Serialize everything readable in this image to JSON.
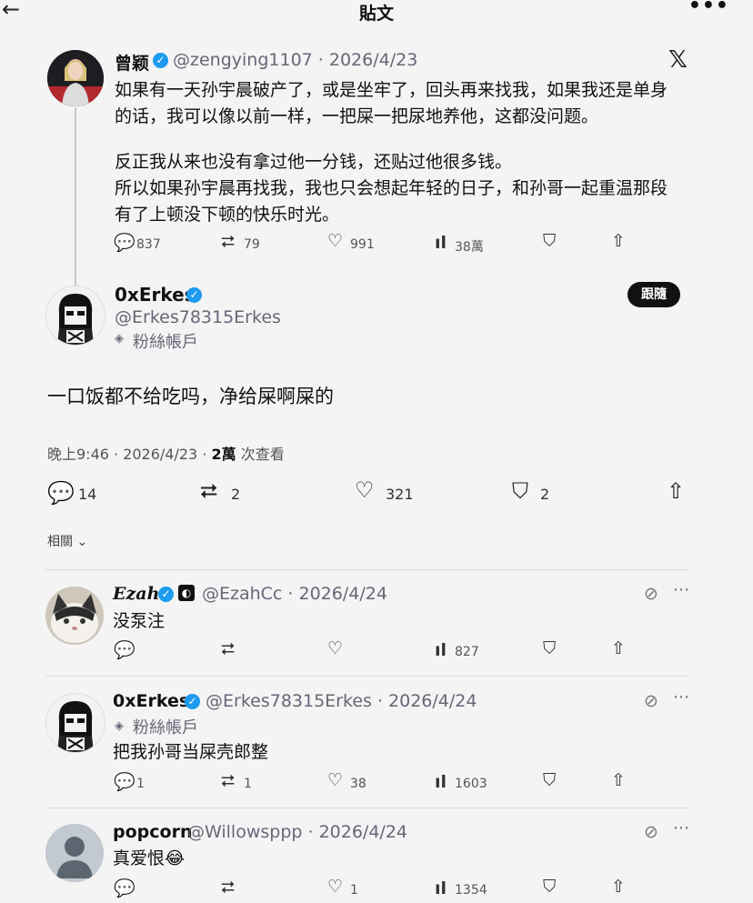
{
  "header": {
    "title": "貼文"
  },
  "quoted": {
    "name": "曾颖",
    "handle": "@zengying1107 · 2026/4/23",
    "lines": [
      "如果有一天孙宇晨破产了，或是坐牢了，回头再来找我，如果我还是单身",
      "的话，我可以像以前一样，一把屎一把尿地养他，这都没问题。",
      "反正我从来也没有拿过他一分钱，还贴过他很多钱。",
      "所以如果孙宇晨再找我，我也只会想起年轻的日子，和孙哥一起重温那段",
      "有了上顿没下顿的快乐时光。"
    ],
    "stats": {
      "replies": "837",
      "reposts": "79",
      "likes": "991",
      "views": "38萬"
    },
    "x_logo": "𝕏"
  },
  "main": {
    "name": "0xErkes",
    "handle": "@Erkes78315Erkes",
    "account_type": "粉絲帳戶",
    "follow_label": "跟隨",
    "text": "一口饭都不给吃吗，净给屎啊屎的",
    "timestamp": "晚上9:46 · 2026/4/23 · ",
    "views_count": "2萬",
    "views_label": " 次查看",
    "stats": {
      "replies": "14",
      "reposts": "2",
      "likes": "321",
      "bookmarks": "2"
    },
    "related_label": "相關"
  },
  "replies": [
    {
      "name": "Ezah",
      "handle": "@EzahCc · 2026/4/24",
      "text": "没泵注",
      "replies": "",
      "reposts": "",
      "likes": "",
      "views": "827"
    },
    {
      "name": "0xErkes",
      "handle": "@Erkes78315Erkes · 2026/4/24",
      "account_type": "粉絲帳戶",
      "text": "把我孙哥当屎壳郎整",
      "replies": "1",
      "reposts": "1",
      "likes": "38",
      "views": "1603"
    },
    {
      "name": "popcorn",
      "handle": "@Willowsppp · 2026/4/24",
      "text": "真爱恨😂",
      "replies": "",
      "reposts": "",
      "likes": "1",
      "views": "1354"
    }
  ]
}
